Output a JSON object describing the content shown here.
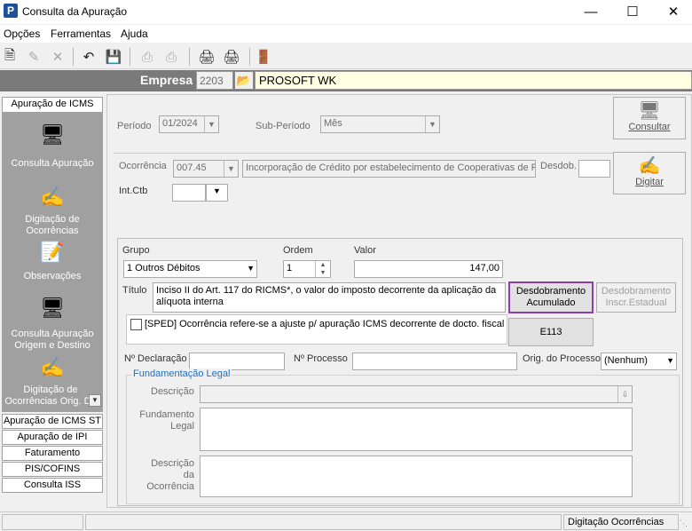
{
  "window": {
    "title": "Consulta da Apuração",
    "icon_letter": "P"
  },
  "menu": [
    "Opções",
    "Ferramentas",
    "Ajuda"
  ],
  "empresa": {
    "label": "Empresa",
    "code": "2203",
    "name": "PROSOFT WK"
  },
  "sidebar": {
    "top_button": "Apuração de ICMS",
    "items": [
      {
        "label": "Consulta Apuração",
        "icon": "monitor-icon"
      },
      {
        "label": "Digitação de Ocorrências",
        "icon": "hand-edit-icon"
      },
      {
        "label": "Observações",
        "icon": "notepad-icon"
      },
      {
        "label": "Consulta Apuração Origem e Destino",
        "icon": "difal-monitor-icon"
      },
      {
        "label": "Digitação de Ocorrências Orig. De",
        "icon": "difal-edit-icon"
      }
    ],
    "bottom_buttons": [
      "Apuração de ICMS ST",
      "Apuração de IPI",
      "Faturamento",
      "PIS/COFINS",
      "Consulta ISS"
    ]
  },
  "form": {
    "periodo_label": "Período",
    "periodo_value": "01/2024",
    "subperiodo_label": "Sub-Período",
    "subperiodo_value": "Mês",
    "consultar_label": "Consultar",
    "ocorrencia_label": "Ocorrência",
    "ocorrencia_code": "007.45",
    "ocorrencia_desc": "Incorporação de Crédito por estabelecimento de Cooperativas de Pr",
    "desdob_label": "Desdob.",
    "digitar_label": "Digitar",
    "intctb_label": "Int.Ctb",
    "grupo_label": "Grupo",
    "grupo_value": "1  Outros Débitos",
    "ordem_label": "Ordem",
    "ordem_value": "1",
    "valor_label": "Valor",
    "valor_value": "147,00",
    "titulo_label": "Título",
    "titulo_value": "Inciso II do Art. 117 do RICMS*, o valor do imposto decorrente da aplicação da alíquota interna",
    "desdob_acum_label": "Desdobramento Acumulado",
    "desdob_inscr_label": "Desdobramento Inscr.Estadual",
    "sped_label": "[SPED] Ocorrência refere-se a ajuste p/ apuração ICMS decorrente de docto. fiscal na",
    "e113_label": "E113",
    "ndeclaracao_label": "Nº Declaração",
    "nprocesso_label": "Nº Processo",
    "origprocesso_label": "Orig. do Processo",
    "origprocesso_value": "(Nenhum)",
    "fund_legend": "Fundamentação Legal",
    "descricao_label": "Descrição",
    "fundamento_label": "Fundamento Legal",
    "descocorr_label": "Descrição da Ocorrência"
  },
  "status": {
    "right": "Digitação Ocorrências"
  }
}
